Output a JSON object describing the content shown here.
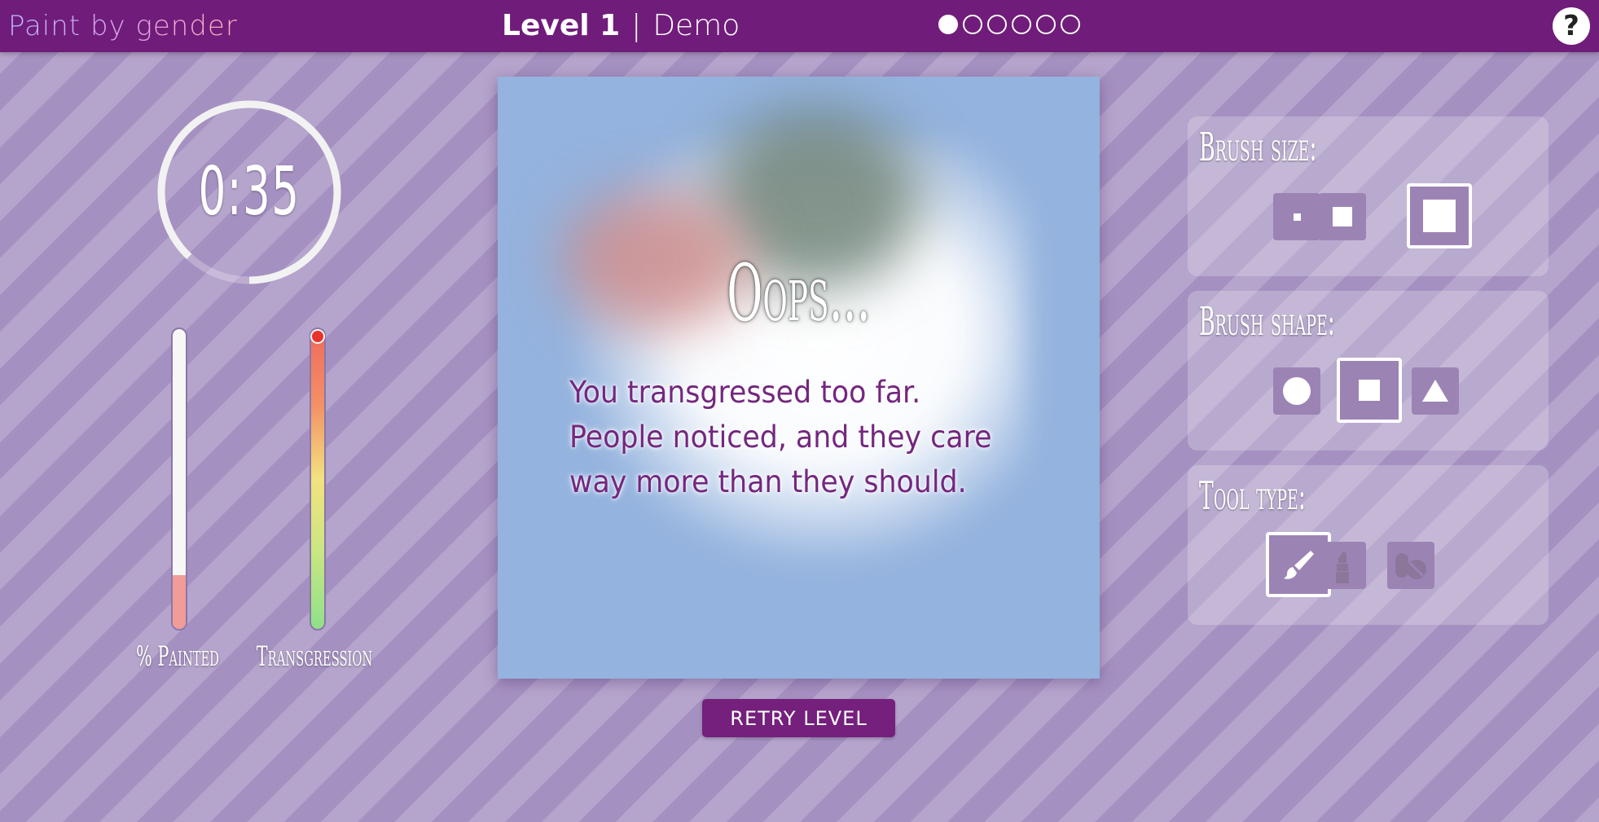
{
  "header": {
    "logo": "Paint by gender",
    "level_label": "Level 1",
    "separator": "|",
    "mode_label": "Demo",
    "progress_dots": {
      "total": 6,
      "filled": 1
    },
    "help_label": "?"
  },
  "timer": {
    "display": "0:35",
    "fraction_remaining": 0.88
  },
  "meters": {
    "painted": {
      "label": "% Painted",
      "value_fraction": 0.18
    },
    "transgression": {
      "label": "Transgression",
      "value_fraction": 1.0
    }
  },
  "canvas": {
    "title": "Oops...",
    "message_lines": [
      "You transgressed too far.",
      "People noticed, and they care",
      "way more than they should."
    ],
    "background_color": "#94b3de"
  },
  "retry_button": {
    "label": "RETRY LEVEL"
  },
  "tools": {
    "brush_size": {
      "title": "Brush size:",
      "options": [
        "small",
        "medium",
        "large"
      ],
      "selected": "large"
    },
    "brush_shape": {
      "title": "Brush shape:",
      "options": [
        "circle",
        "square",
        "triangle"
      ],
      "selected": "square"
    },
    "tool_type": {
      "title": "Tool type:",
      "options": [
        "paintbrush-icon",
        "lipstick-icon",
        "pills-icon"
      ],
      "selected": "paintbrush-icon"
    }
  },
  "colors": {
    "header": "#701c7a",
    "accent": "#74207c",
    "message_text": "#74277f"
  }
}
